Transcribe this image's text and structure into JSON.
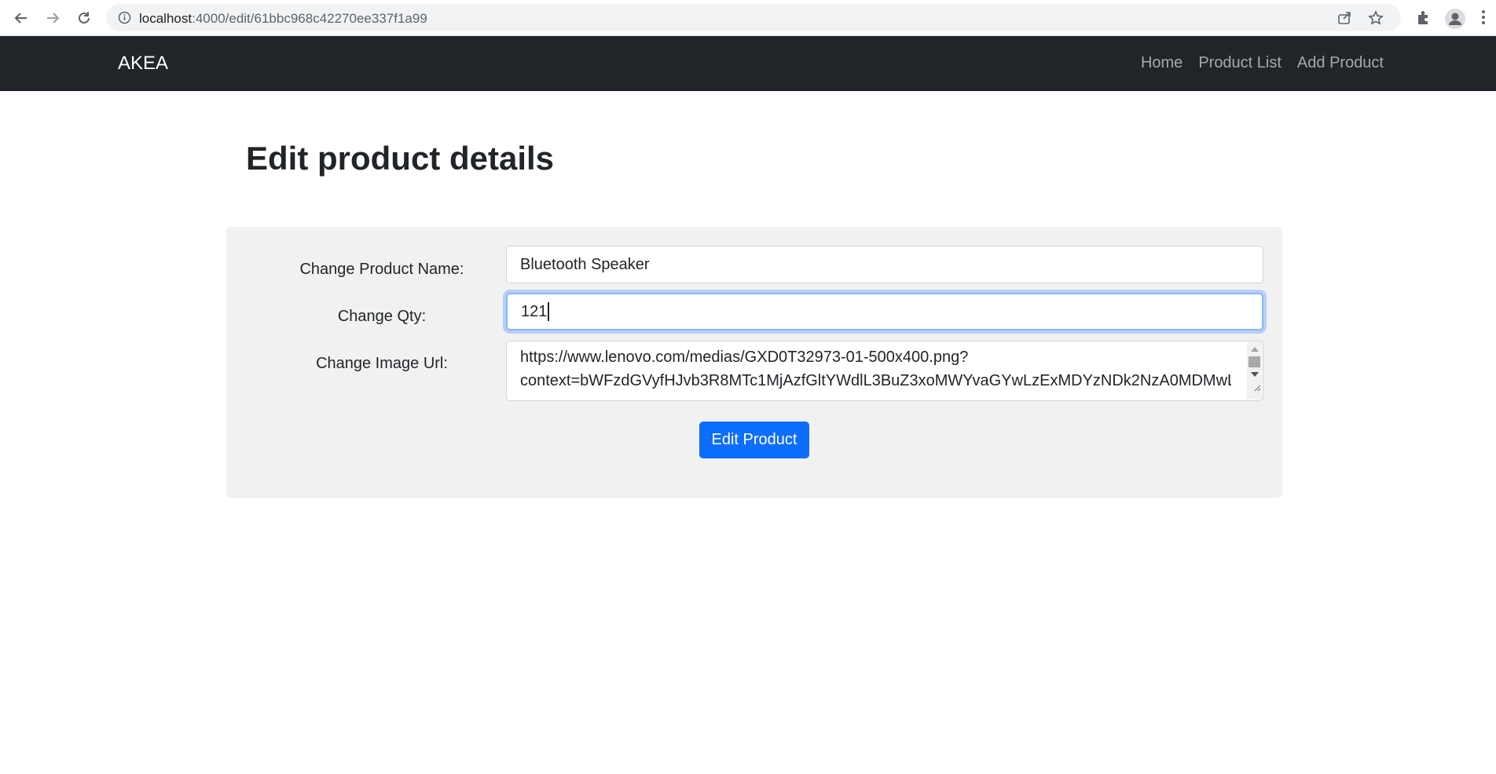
{
  "browser": {
    "url_host": "localhost",
    "url_path": ":4000/edit/61bbc968c42270ee337f1a99"
  },
  "navbar": {
    "brand": "AKEA",
    "links": [
      "Home",
      "Product List",
      "Add Product"
    ]
  },
  "page": {
    "title": "Edit product details"
  },
  "form": {
    "name_label": "Change Product Name:",
    "name_value": "Bluetooth Speaker",
    "qty_label": "Change Qty:",
    "qty_value": "121",
    "image_label": "Change Image Url:",
    "image_value_line1": "https://www.lenovo.com/medias/GXD0T32973-01-500x400.png?",
    "image_value_line2": "context=bWFzdGVyfHJvb3R8MTc1MjAzfGltYWdlL3BuZ3xoMWYvaGYwLzExMDYzNDk2NzA0MDMwLnB",
    "submit_label": "Edit Product"
  },
  "colors": {
    "navbar_bg": "#212529",
    "primary": "#0d6efd",
    "card_bg": "#f1f1f1"
  }
}
